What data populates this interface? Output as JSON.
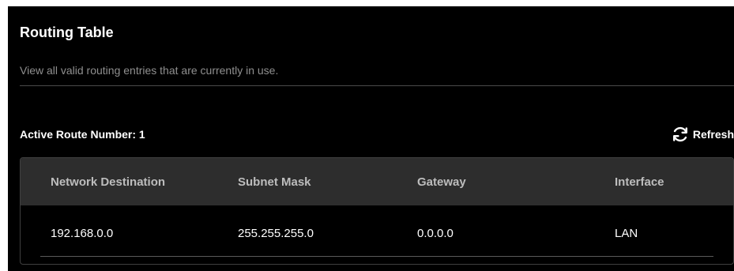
{
  "header": {
    "title": "Routing Table",
    "subtitle": "View all valid routing entries that are currently in use."
  },
  "toolbar": {
    "active_routes_label": "Active Route Number: 1",
    "refresh_label": "Refresh",
    "refresh_icon": "refresh-icon"
  },
  "table": {
    "columns": [
      "Network Destination",
      "Subnet Mask",
      "Gateway",
      "Interface"
    ],
    "rows": [
      [
        "192.168.0.0",
        "255.255.255.0",
        "0.0.0.0",
        "LAN"
      ]
    ]
  },
  "colors": {
    "panel_bg": "#000000",
    "header_row_bg": "#2d2d2d",
    "muted_text": "#8f8f8f"
  }
}
